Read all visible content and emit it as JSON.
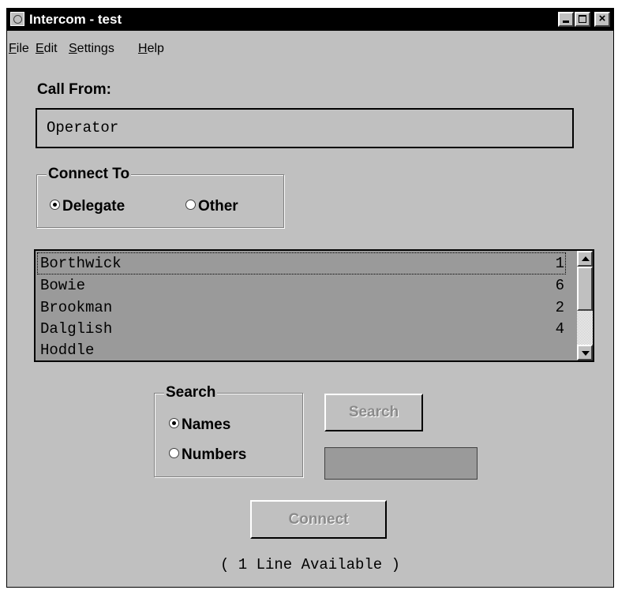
{
  "window": {
    "title": "Intercom - test",
    "controls": {
      "minimize": "minimize",
      "maximize": "maximize",
      "close": "×"
    }
  },
  "menu": [
    {
      "mnemonic": "F",
      "rest": "ile"
    },
    {
      "mnemonic": "E",
      "rest": "dit"
    },
    {
      "mnemonic": "S",
      "rest": "ettings"
    },
    {
      "mnemonic": "H",
      "rest": "elp"
    }
  ],
  "call_from": {
    "label": "Call From:",
    "value": "Operator"
  },
  "connect_to": {
    "title": "Connect To",
    "options": [
      {
        "label": "Delegate",
        "checked": true
      },
      {
        "label": "Other",
        "checked": false
      }
    ]
  },
  "list": {
    "rows": [
      {
        "name": "Borthwick",
        "number": "1",
        "selected": true
      },
      {
        "name": "Bowie",
        "number": "6",
        "selected": false
      },
      {
        "name": "Brookman",
        "number": "2",
        "selected": false
      },
      {
        "name": "Dalglish",
        "number": "4",
        "selected": false
      },
      {
        "name": "Hoddle",
        "number": "",
        "selected": false
      }
    ]
  },
  "search_group": {
    "title": "Search",
    "options": [
      {
        "label": "Names",
        "checked": true
      },
      {
        "label": "Numbers",
        "checked": false
      }
    ]
  },
  "search_button": "Search",
  "search_input": {
    "value": ""
  },
  "connect_button": "Connect",
  "status": "( 1 Line Available )",
  "colors": {
    "window_bg": "#c0c0c0",
    "list_bg": "#9a9a9a",
    "titlebar": "#000000",
    "disabled_text": "#8a8a8a"
  }
}
